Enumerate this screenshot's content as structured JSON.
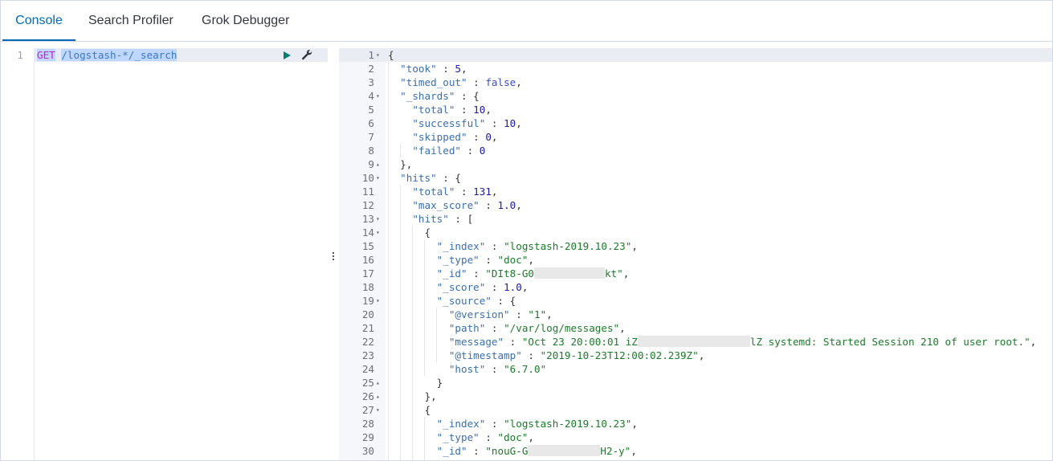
{
  "tabs": [
    "Console",
    "Search Profiler",
    "Grok Debugger"
  ],
  "active_tab": "Console",
  "request": {
    "line_number": "1",
    "method": "GET",
    "path": "/logstash-*/_search"
  },
  "response_lines": [
    {
      "n": "1",
      "fold": "▾",
      "t": [
        [
          "p",
          "{"
        ]
      ]
    },
    {
      "n": "2",
      "t": [
        [
          "k",
          "  \"took\""
        ],
        [
          "p",
          " : "
        ],
        [
          "n",
          "5"
        ],
        [
          "p",
          ","
        ]
      ]
    },
    {
      "n": "3",
      "t": [
        [
          "k",
          "  \"timed_out\""
        ],
        [
          "p",
          " : "
        ],
        [
          "b",
          "false"
        ],
        [
          "p",
          ","
        ]
      ]
    },
    {
      "n": "4",
      "fold": "▾",
      "t": [
        [
          "k",
          "  \"_shards\""
        ],
        [
          "p",
          " : {"
        ]
      ]
    },
    {
      "n": "5",
      "t": [
        [
          "k",
          "    \"total\""
        ],
        [
          "p",
          " : "
        ],
        [
          "n",
          "10"
        ],
        [
          "p",
          ","
        ]
      ]
    },
    {
      "n": "6",
      "t": [
        [
          "k",
          "    \"successful\""
        ],
        [
          "p",
          " : "
        ],
        [
          "n",
          "10"
        ],
        [
          "p",
          ","
        ]
      ]
    },
    {
      "n": "7",
      "t": [
        [
          "k",
          "    \"skipped\""
        ],
        [
          "p",
          " : "
        ],
        [
          "n",
          "0"
        ],
        [
          "p",
          ","
        ]
      ]
    },
    {
      "n": "8",
      "t": [
        [
          "k",
          "    \"failed\""
        ],
        [
          "p",
          " : "
        ],
        [
          "n",
          "0"
        ]
      ]
    },
    {
      "n": "9",
      "fold": "▴",
      "t": [
        [
          "p",
          "  },"
        ]
      ]
    },
    {
      "n": "10",
      "fold": "▾",
      "t": [
        [
          "k",
          "  \"hits\""
        ],
        [
          "p",
          " : {"
        ]
      ]
    },
    {
      "n": "11",
      "t": [
        [
          "k",
          "    \"total\""
        ],
        [
          "p",
          " : "
        ],
        [
          "n",
          "131"
        ],
        [
          "p",
          ","
        ]
      ]
    },
    {
      "n": "12",
      "t": [
        [
          "k",
          "    \"max_score\""
        ],
        [
          "p",
          " : "
        ],
        [
          "n",
          "1.0"
        ],
        [
          "p",
          ","
        ]
      ]
    },
    {
      "n": "13",
      "fold": "▾",
      "t": [
        [
          "k",
          "    \"hits\""
        ],
        [
          "p",
          " : ["
        ]
      ]
    },
    {
      "n": "14",
      "fold": "▾",
      "t": [
        [
          "p",
          "      {"
        ]
      ]
    },
    {
      "n": "15",
      "t": [
        [
          "k",
          "        \"_index\""
        ],
        [
          "p",
          " : "
        ],
        [
          "s",
          "\"logstash-2019.10.23\""
        ],
        [
          "p",
          ","
        ]
      ]
    },
    {
      "n": "16",
      "t": [
        [
          "k",
          "        \"_type\""
        ],
        [
          "p",
          " : "
        ],
        [
          "s",
          "\"doc\""
        ],
        [
          "p",
          ","
        ]
      ]
    },
    {
      "n": "17",
      "t": [
        [
          "k",
          "        \"_id\""
        ],
        [
          "p",
          " : "
        ],
        [
          "s",
          "\"DIt8-G0"
        ],
        [
          "r",
          "88"
        ],
        [
          "s",
          "kt\""
        ],
        [
          "p",
          ","
        ]
      ]
    },
    {
      "n": "18",
      "t": [
        [
          "k",
          "        \"_score\""
        ],
        [
          "p",
          " : "
        ],
        [
          "n",
          "1.0"
        ],
        [
          "p",
          ","
        ]
      ]
    },
    {
      "n": "19",
      "fold": "▾",
      "t": [
        [
          "k",
          "        \"_source\""
        ],
        [
          "p",
          " : {"
        ]
      ]
    },
    {
      "n": "20",
      "t": [
        [
          "k",
          "          \"@version\""
        ],
        [
          "p",
          " : "
        ],
        [
          "s",
          "\"1\""
        ],
        [
          "p",
          ","
        ]
      ]
    },
    {
      "n": "21",
      "t": [
        [
          "k",
          "          \"path\""
        ],
        [
          "p",
          " : "
        ],
        [
          "s",
          "\"/var/log/messages\""
        ],
        [
          "p",
          ","
        ]
      ]
    },
    {
      "n": "22",
      "t": [
        [
          "k",
          "          \"message\""
        ],
        [
          "p",
          " : "
        ],
        [
          "s",
          "\"Oct 23 20:00:01 iZ"
        ],
        [
          "r",
          "140"
        ],
        [
          "s",
          "lZ systemd: Started Session 210 of user root.\""
        ],
        [
          "p",
          ","
        ]
      ]
    },
    {
      "n": "23",
      "t": [
        [
          "k",
          "          \"@timestamp\""
        ],
        [
          "p",
          " : "
        ],
        [
          "s",
          "\"2019-10-23T12:00:02.239Z\""
        ],
        [
          "p",
          ","
        ]
      ]
    },
    {
      "n": "24",
      "t": [
        [
          "k",
          "          \"host\""
        ],
        [
          "p",
          " : "
        ],
        [
          "s",
          "\"6.7.0\""
        ]
      ]
    },
    {
      "n": "25",
      "fold": "▴",
      "t": [
        [
          "p",
          "        }"
        ]
      ]
    },
    {
      "n": "26",
      "fold": "▴",
      "t": [
        [
          "p",
          "      },"
        ]
      ]
    },
    {
      "n": "27",
      "fold": "▾",
      "t": [
        [
          "p",
          "      {"
        ]
      ]
    },
    {
      "n": "28",
      "t": [
        [
          "k",
          "        \"_index\""
        ],
        [
          "p",
          " : "
        ],
        [
          "s",
          "\"logstash-2019.10.23\""
        ],
        [
          "p",
          ","
        ]
      ]
    },
    {
      "n": "29",
      "t": [
        [
          "k",
          "        \"_type\""
        ],
        [
          "p",
          " : "
        ],
        [
          "s",
          "\"doc\""
        ],
        [
          "p",
          ","
        ]
      ]
    },
    {
      "n": "30",
      "t": [
        [
          "k",
          "        \"_id\""
        ],
        [
          "p",
          " : "
        ],
        [
          "s",
          "\"nouG-G"
        ],
        [
          "r",
          "90"
        ],
        [
          "s",
          "H2-y\""
        ],
        [
          "p",
          ","
        ]
      ]
    }
  ],
  "icons": {
    "run": "play-icon",
    "settings": "wrench-icon",
    "resize": "resize-handle-icon"
  },
  "colors": {
    "accent": "#006bb4",
    "run": "#017d73"
  }
}
